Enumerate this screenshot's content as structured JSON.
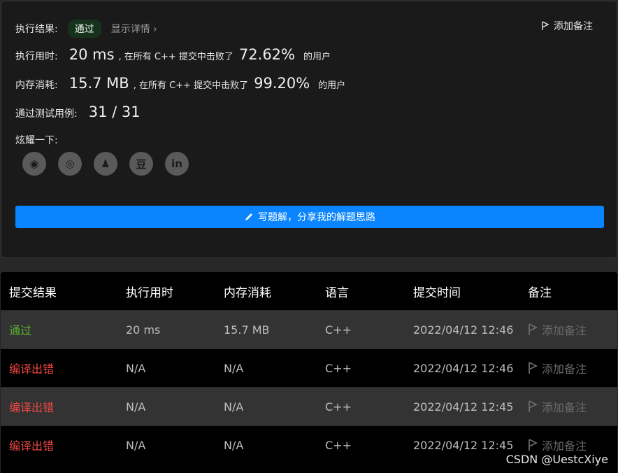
{
  "summary": {
    "result_label": "执行结果:",
    "result_value": "通过",
    "detail_link": "显示详情 ›",
    "add_note": "添加备注",
    "time_label": "执行用时:",
    "time_value": "20 ms",
    "time_mid": ", 在所有 C++ 提交中击败了",
    "time_pct": "72.62%",
    "time_suffix": "的用户",
    "mem_label": "内存消耗:",
    "mem_value": "15.7 MB",
    "mem_mid": ", 在所有 C++ 提交中击败了",
    "mem_pct": "99.20%",
    "mem_suffix": "的用户",
    "cases_label": "通过测试用例:",
    "cases_value": "31 / 31",
    "share_label": "炫耀一下:",
    "share_icons": [
      "wechat-icon",
      "weibo-icon",
      "qq-icon",
      "douban-icon",
      "linkedin-icon"
    ],
    "share_glyphs": [
      "◉",
      "◎",
      "♟",
      "豆",
      "in"
    ],
    "cta_label": "写题解，分享我的解题思路"
  },
  "table": {
    "headers": [
      "提交结果",
      "执行用时",
      "内存消耗",
      "语言",
      "提交时间",
      "备注"
    ],
    "rows": [
      {
        "status": "通过",
        "status_type": "pass",
        "time": "20 ms",
        "memory": "15.7 MB",
        "lang": "C++",
        "submitted": "2022/04/12 12:46",
        "note": "添加备注"
      },
      {
        "status": "编译出错",
        "status_type": "error",
        "time": "N/A",
        "memory": "N/A",
        "lang": "C++",
        "submitted": "2022/04/12 12:46",
        "note": "添加备注"
      },
      {
        "status": "编译出错",
        "status_type": "error",
        "time": "N/A",
        "memory": "N/A",
        "lang": "C++",
        "submitted": "2022/04/12 12:45",
        "note": "添加备注"
      },
      {
        "status": "编译出错",
        "status_type": "error",
        "time": "N/A",
        "memory": "N/A",
        "lang": "C++",
        "submitted": "2022/04/12 12:45",
        "note": "添加备注"
      }
    ]
  },
  "colors": {
    "accent": "#0a84ff",
    "pass": "#5bb030",
    "error": "#ef4743"
  },
  "watermark": "CSDN @UestcXiye"
}
